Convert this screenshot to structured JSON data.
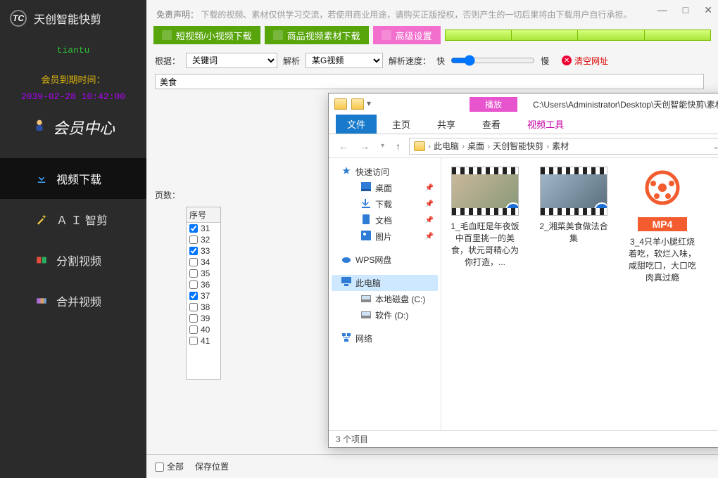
{
  "app": {
    "title": "天创智能快剪",
    "logo_letter": "TC",
    "username": "tiantu",
    "expiry_label": "会员到期时间：",
    "expiry_value": "2039-02-28 10:42:00",
    "vip_center": "会员中心"
  },
  "nav": [
    {
      "key": "download",
      "label": "视频下载",
      "active": true
    },
    {
      "key": "ai",
      "label": "Ａ Ｉ 智剪",
      "active": false
    },
    {
      "key": "split",
      "label": "分割视频",
      "active": false
    },
    {
      "key": "merge",
      "label": "合并视频",
      "active": false
    }
  ],
  "window_controls": {
    "min": "—",
    "max": "□",
    "close": "✕"
  },
  "disclaimer": {
    "label": "免责声明：",
    "text": "下载的视频、素材仅供学习交流，若使用商业用途，请购买正版授权，否则产生的一切后果将由下载用户自行承担。"
  },
  "toolbar": {
    "btn1": "短视频/小视频下载",
    "btn2": "商品视频素材下载",
    "btn3": "高级设置"
  },
  "controls": {
    "root_label": "根据：",
    "root_select": "关键词",
    "parse_label": "解析",
    "parse_select": "某G视频",
    "speed_label": "解析速度：",
    "speed_fast": "快",
    "speed_slow": "慢",
    "clear": "清空网址"
  },
  "search": {
    "value": "美食"
  },
  "page_label": "页数：",
  "list": {
    "header": "序号",
    "rows": [
      {
        "n": "31",
        "c": true
      },
      {
        "n": "32",
        "c": false
      },
      {
        "n": "33",
        "c": true
      },
      {
        "n": "34",
        "c": false
      },
      {
        "n": "35",
        "c": false
      },
      {
        "n": "36",
        "c": false
      },
      {
        "n": "37",
        "c": true
      },
      {
        "n": "38",
        "c": false
      },
      {
        "n": "39",
        "c": false
      },
      {
        "n": "40",
        "c": false
      },
      {
        "n": "41",
        "c": false
      }
    ]
  },
  "bottom": {
    "select_all_label": "全部",
    "save_label": "保存位置",
    "status_items": "3 个项目"
  },
  "explorer": {
    "play_tab": "播放",
    "full_path": "C:\\Users\\Administrator\\Desktop\\天创智能快剪\\素材",
    "win": {
      "min": "—",
      "max": "□",
      "close": "✕"
    },
    "ribbon": [
      {
        "label": "文件",
        "active": true
      },
      {
        "label": "主页"
      },
      {
        "label": "共享"
      },
      {
        "label": "查看"
      },
      {
        "label": "视频工具",
        "pink": true
      }
    ],
    "crumbs": [
      "此电脑",
      "桌面",
      "天创智能快剪",
      "素材"
    ],
    "search_placeholder": "",
    "tree": {
      "quick": "快速访问",
      "desktop": "桌面",
      "downloads": "下载",
      "documents": "文档",
      "pictures": "图片",
      "wps": "WPS网盘",
      "thispc": "此电脑",
      "drive_c": "本地磁盘 (C:)",
      "drive_d": "软件 (D:)",
      "network": "网络"
    },
    "files": [
      {
        "name": "1_毛血旺是年夜饭中百里挑一的美食，状元哥精心为你打造，...",
        "type": "video"
      },
      {
        "name": "2_湘菜美食做法合集",
        "type": "video_fish"
      },
      {
        "name": "3_4只羊小腿红烧着吃，软烂入味，咸甜吃口，大口吃肉真过瘾",
        "type": "mp4"
      }
    ],
    "mp4_badge": "MP4",
    "status": "3 个项目"
  }
}
